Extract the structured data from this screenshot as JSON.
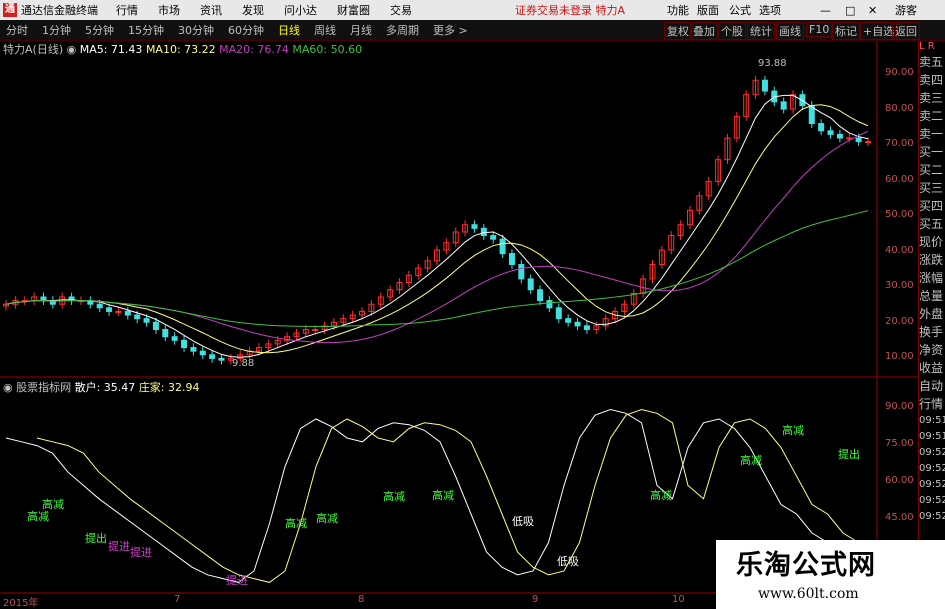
{
  "titlebar": {
    "app_title": "通达信金融终端",
    "menus": [
      "行情",
      "市场",
      "资讯",
      "发现",
      "问小达",
      "财富圈",
      "交易"
    ],
    "warning": "证券交易未登录",
    "stock": "特力A",
    "right": [
      "功能",
      "版面",
      "公式",
      "选项"
    ],
    "guest": "游客"
  },
  "toolbar": {
    "periods": [
      "分时",
      "1分钟",
      "5分钟",
      "15分钟",
      "30分钟",
      "60分钟",
      "日线",
      "周线",
      "月线",
      "多周期",
      "更多 >"
    ],
    "selected": "日线",
    "right_buttons": [
      "复权",
      "叠加",
      "个股",
      "统计",
      "画线",
      "F10",
      "标记",
      "+自选",
      "返回"
    ]
  },
  "info": {
    "name": "特力A(日线)",
    "ma5": "MA5: 71.43",
    "ma10": "MA10: 73.22",
    "ma20": "MA20: 76.74",
    "ma60": "MA60: 50.60"
  },
  "price_axis": [
    "90.00",
    "80.00",
    "70.00",
    "60.00",
    "50.00",
    "40.00",
    "30.00",
    "20.00",
    "10.00"
  ],
  "price_labels": {
    "high": "93.88",
    "low": "9.88"
  },
  "indicator": {
    "name": "股票指标网",
    "sanhu": "散户: 35.47",
    "zhuangjia": "庄家: 32.94",
    "axis": [
      "90.00",
      "75.00",
      "60.00",
      "45.00"
    ],
    "signals": [
      "高减",
      "高减",
      "提出",
      "提进",
      "提进",
      "高减",
      "高减",
      "高减",
      "高减",
      "低吸",
      "高减",
      "低吸",
      "高减",
      "高减",
      "提出",
      "提进"
    ]
  },
  "side": {
    "top": "委托",
    "items": [
      "卖五",
      "卖四",
      "卖三",
      "卖二",
      "卖一",
      "买一",
      "买二",
      "买三",
      "买四",
      "买五",
      "现价",
      "涨跌",
      "涨幅",
      "总量",
      "外盘",
      "换手",
      "净资",
      "收益",
      "自动",
      "行情",
      "09:51",
      "09:51",
      "09:52",
      "09:52",
      "09:52",
      "09:52",
      "09:52"
    ]
  },
  "dates": [
    "2015年",
    "7",
    "8",
    "9",
    "10"
  ],
  "watermark": {
    "title": "乐淘公式网",
    "url": "www.60lt.com"
  },
  "colors": {
    "up": "#ff3030",
    "down": "#40e0e0",
    "ma5": "#ffffff",
    "ma10": "#ffff80",
    "ma20": "#c040c0",
    "ma60": "#40c040"
  }
}
